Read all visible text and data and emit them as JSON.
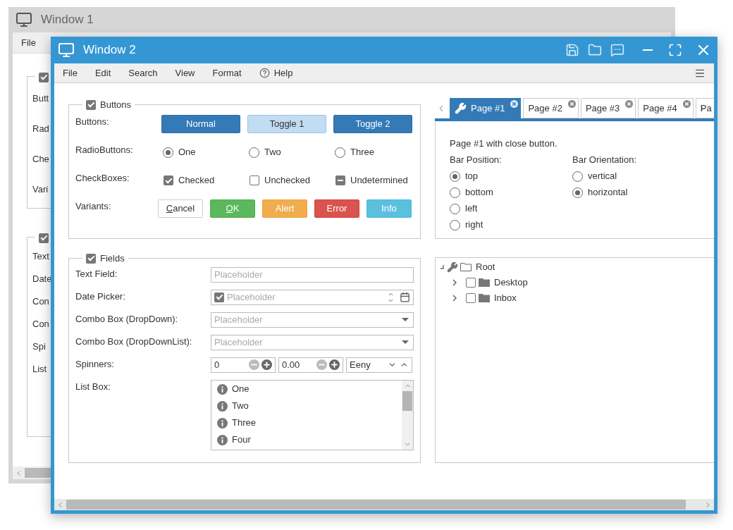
{
  "background_window": {
    "title": "Window 1",
    "menu": [
      "File"
    ],
    "groups": [
      {
        "checked": true,
        "labels": [
          "Butt",
          "Rad",
          "Che",
          "Vari"
        ]
      },
      {
        "checked": true,
        "labels": [
          "Text",
          "Date",
          "Con",
          "Con",
          "Spi",
          "List"
        ]
      }
    ]
  },
  "window": {
    "title": "Window 2",
    "menu": [
      {
        "label": "File",
        "kind": "plain"
      },
      {
        "label": "Edit",
        "kind": "plain"
      },
      {
        "label": "Search",
        "kind": "plain"
      },
      {
        "label": "View",
        "kind": "plain"
      },
      {
        "label": "Format",
        "kind": "plain"
      },
      {
        "label": "Help",
        "kind": "help"
      }
    ],
    "buttons_group": {
      "title": "Buttons",
      "checked": true,
      "rows": [
        {
          "kind": "buttons",
          "label": "Buttons:",
          "items": [
            {
              "label": "Normal",
              "kind": "normal"
            },
            {
              "label": "Toggle 1",
              "kind": "toggle",
              "selected": true
            },
            {
              "label": "Toggle 2",
              "kind": "toggle",
              "selected": false
            }
          ]
        },
        {
          "kind": "radios",
          "label": "RadioButtons:",
          "items": [
            {
              "label": "One",
              "selected": true
            },
            {
              "label": "Two",
              "selected": false
            },
            {
              "label": "Three",
              "selected": false
            }
          ]
        },
        {
          "kind": "checkboxes",
          "label": "CheckBoxes:",
          "items": [
            {
              "label": "Checked",
              "checked": true,
              "indeterminate": false
            },
            {
              "label": "Unchecked",
              "checked": false,
              "indeterminate": false
            },
            {
              "label": "Undetermined",
              "checked": true,
              "indeterminate": true
            }
          ]
        },
        {
          "kind": "variants",
          "label": "Variants:",
          "items": [
            {
              "label": "Cancel",
              "kind": "default",
              "mnemonic": true
            },
            {
              "label": "OK",
              "kind": "success",
              "mnemonic": true
            },
            {
              "label": "Alert",
              "kind": "warning",
              "mnemonic": false
            },
            {
              "label": "Error",
              "kind": "danger",
              "mnemonic": false
            },
            {
              "label": "Info",
              "kind": "info",
              "mnemonic": false
            }
          ]
        }
      ]
    },
    "fields_group": {
      "title": "Fields",
      "checked": true,
      "rows": [
        {
          "kind": "text",
          "label": "Text Field:",
          "placeholder": "Placeholder"
        },
        {
          "kind": "date",
          "label": "Date Picker:",
          "placeholder": "Placeholder",
          "checked": true
        },
        {
          "kind": "combo",
          "label": "Combo Box (DropDown):",
          "placeholder": "Placeholder"
        },
        {
          "kind": "combo",
          "label": "Combo Box (DropDownList):",
          "placeholder": "Placeholder"
        },
        {
          "kind": "spinners",
          "label": "Spinners:",
          "spinners": [
            {
              "kind": "number",
              "value": "0"
            },
            {
              "kind": "number",
              "value": "0.00"
            },
            {
              "kind": "list",
              "value": "Eeny"
            }
          ]
        },
        {
          "kind": "listbox",
          "label": "List Box:",
          "items": [
            "One",
            "Two",
            "Three",
            "Four"
          ]
        }
      ]
    },
    "tabs": [
      {
        "label": "Page #1",
        "selected": true,
        "has_icon": true,
        "closable": true
      },
      {
        "label": "Page #2",
        "selected": false,
        "has_icon": false,
        "closable": true
      },
      {
        "label": "Page #3",
        "selected": false,
        "has_icon": false,
        "closable": true
      },
      {
        "label": "Page #4",
        "selected": false,
        "has_icon": false,
        "closable": true
      },
      {
        "label": "Pa",
        "selected": false,
        "has_icon": false,
        "closable": false
      }
    ],
    "tab_page": {
      "description": "Page #1 with close button.",
      "option_groups": [
        {
          "label": "Bar Position:",
          "options": [
            {
              "label": "top",
              "selected": true
            },
            {
              "label": "bottom",
              "selected": false
            },
            {
              "label": "left",
              "selected": false
            },
            {
              "label": "right",
              "selected": false
            }
          ]
        },
        {
          "label": "Bar Orientation:",
          "options": [
            {
              "label": "vertical",
              "selected": false
            },
            {
              "label": "horizontal",
              "selected": true
            }
          ]
        }
      ]
    },
    "tree": {
      "label": "Root",
      "expanded": true,
      "children": [
        {
          "label": "Desktop",
          "checked": false,
          "expanded": false
        },
        {
          "label": "Inbox",
          "checked": false,
          "expanded": false
        }
      ]
    }
  }
}
